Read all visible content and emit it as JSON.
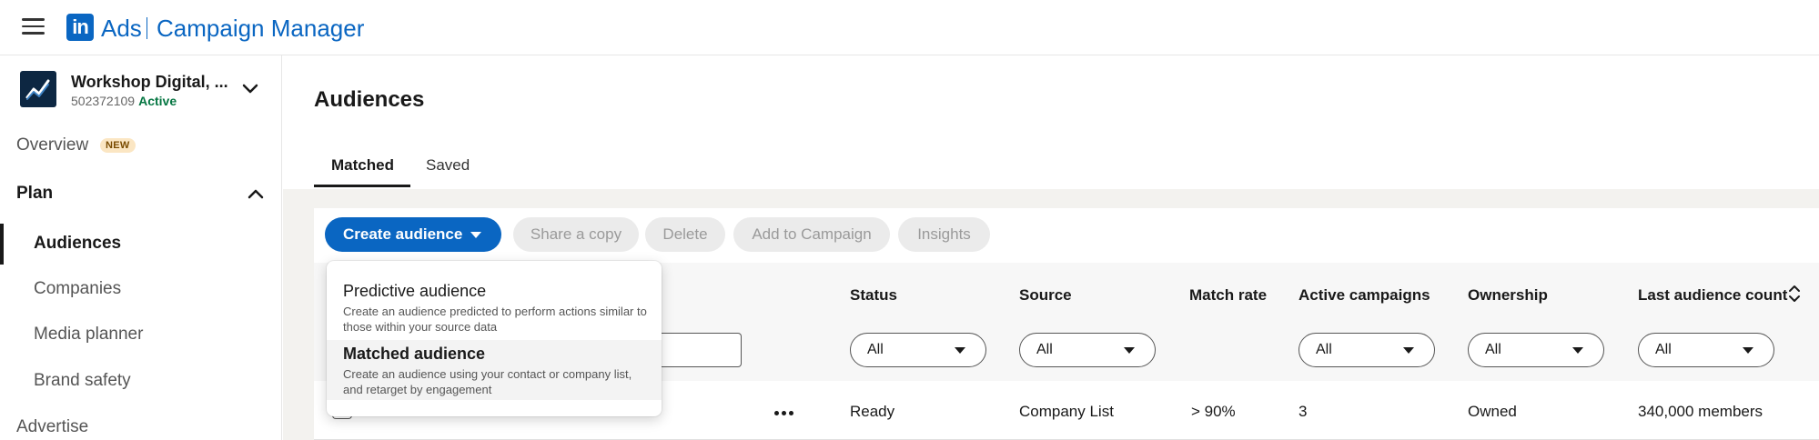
{
  "header": {
    "logo_text": "in",
    "product": "Ads",
    "app_title": "Campaign Manager"
  },
  "account": {
    "name": "Workshop Digital, ...",
    "id": "502372109",
    "status": "Active"
  },
  "nav": {
    "overview": "Overview",
    "overview_badge": "NEW",
    "plan": "Plan",
    "plan_items": [
      "Audiences",
      "Companies",
      "Media planner",
      "Brand safety"
    ],
    "advertise": "Advertise"
  },
  "page": {
    "title": "Audiences",
    "tabs": [
      "Matched",
      "Saved"
    ]
  },
  "toolbar": {
    "create": "Create audience",
    "share": "Share a copy",
    "delete": "Delete",
    "add_to_campaign": "Add to Campaign",
    "insights": "Insights"
  },
  "table": {
    "columns": [
      "Status",
      "Source",
      "Match rate",
      "Active campaigns",
      "Ownership",
      "Last audience count"
    ],
    "filter_value": "All",
    "row": {
      "status": "Ready",
      "source": "Company List",
      "match_rate": "> 90%",
      "active_campaigns": "3",
      "ownership": "Owned",
      "last_count": "340,000 members"
    }
  },
  "dropdown": {
    "items": [
      {
        "title": "Predictive audience",
        "desc": "Create an audience predicted to perform actions similar to those within your source data"
      },
      {
        "title": "Matched audience",
        "desc": "Create an audience using your contact or company list, and retarget by engagement"
      }
    ]
  },
  "colors": {
    "brand": "#0a66c2",
    "active_status": "#057642",
    "badge_bg": "#fbe6c3"
  }
}
